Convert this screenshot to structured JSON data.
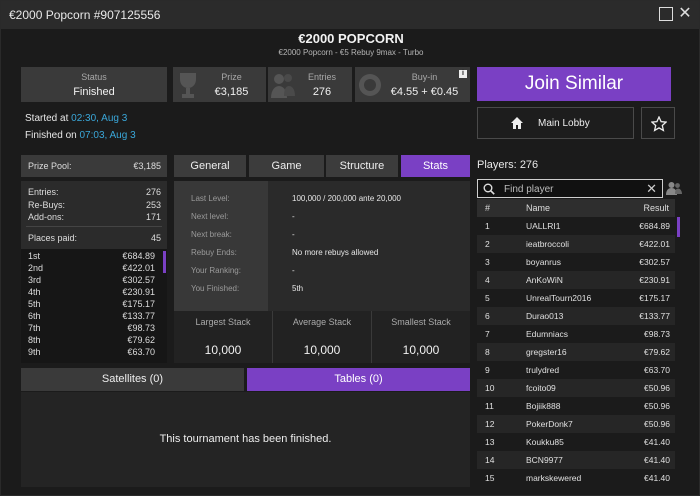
{
  "window": {
    "title": "€2000 Popcorn #907125556"
  },
  "header": {
    "title": "€2000 POPCORN",
    "subtitle": "€2000 Popcorn - €5 Rebuy 9max - Turbo"
  },
  "cards": {
    "status": {
      "label": "Status",
      "value": "Finished"
    },
    "prize": {
      "label": "Prize",
      "value": "€3,185"
    },
    "entries": {
      "label": "Entries",
      "value": "276"
    },
    "buyin": {
      "label": "Buy-in",
      "value": "€4.55 + €0.45"
    }
  },
  "times": {
    "started_label": "Started at",
    "started_value": "02:30, Aug 3",
    "finished_label": "Finished on",
    "finished_value": "07:03, Aug 3"
  },
  "actions": {
    "join": "Join Similar",
    "lobby": "Main Lobby"
  },
  "left_panel": {
    "prize_pool_label": "Prize Pool:",
    "prize_pool_value": "€3,185",
    "entries_label": "Entries:",
    "entries_value": "276",
    "rebuys_label": "Re-Buys:",
    "rebuys_value": "253",
    "addons_label": "Add-ons:",
    "addons_value": "171",
    "places_label": "Places paid:",
    "places_value": "45",
    "places": [
      {
        "place": "1st",
        "prize": "€684.89"
      },
      {
        "place": "2nd",
        "prize": "€422.01"
      },
      {
        "place": "3rd",
        "prize": "€302.57"
      },
      {
        "place": "4th",
        "prize": "€230.91"
      },
      {
        "place": "5th",
        "prize": "€175.17"
      },
      {
        "place": "6th",
        "prize": "€133.77"
      },
      {
        "place": "7th",
        "prize": "€98.73"
      },
      {
        "place": "8th",
        "prize": "€79.62"
      },
      {
        "place": "9th",
        "prize": "€63.70"
      }
    ]
  },
  "tabs": [
    "General",
    "Game",
    "Structure",
    "Stats"
  ],
  "stats": {
    "rows": [
      {
        "label": "Last Level:",
        "value": "100,000 / 200,000 ante 20,000"
      },
      {
        "label": "Next level:",
        "value": "-"
      },
      {
        "label": "Next break:",
        "value": "-"
      },
      {
        "label": "Rebuy Ends:",
        "value": "No more rebuys allowed"
      },
      {
        "label": "Your Ranking:",
        "value": "-"
      },
      {
        "label": "You Finished:",
        "value": "5th"
      }
    ],
    "stacks": [
      {
        "label": "Largest Stack",
        "value": "10,000"
      },
      {
        "label": "Average Stack",
        "value": "10,000"
      },
      {
        "label": "Smallest Stack",
        "value": "10,000"
      }
    ]
  },
  "bottom": {
    "tab_satellites": "Satellites (0)",
    "tab_tables": "Tables (0)",
    "message": "This tournament has been finished."
  },
  "players": {
    "header_label": "Players:",
    "count": "276",
    "search_placeholder": "Find player",
    "columns": [
      "#",
      "Name",
      "Result"
    ],
    "rows": [
      {
        "rank": "1",
        "name": "UALLRI1",
        "result": "€684.89"
      },
      {
        "rank": "2",
        "name": "ieatbroccoli",
        "result": "€422.01"
      },
      {
        "rank": "3",
        "name": "boyanrus",
        "result": "€302.57"
      },
      {
        "rank": "4",
        "name": "AnKoWiN",
        "result": "€230.91"
      },
      {
        "rank": "5",
        "name": "UnrealTourn2016",
        "result": "€175.17"
      },
      {
        "rank": "6",
        "name": "Durao013",
        "result": "€133.77"
      },
      {
        "rank": "7",
        "name": "Edumniacs",
        "result": "€98.73"
      },
      {
        "rank": "8",
        "name": "gregster16",
        "result": "€79.62"
      },
      {
        "rank": "9",
        "name": "trulydred",
        "result": "€63.70"
      },
      {
        "rank": "10",
        "name": "fcoito09",
        "result": "€50.96"
      },
      {
        "rank": "11",
        "name": "Bojiik888",
        "result": "€50.96"
      },
      {
        "rank": "12",
        "name": "PokerDonk7",
        "result": "€50.96"
      },
      {
        "rank": "13",
        "name": "Koukku85",
        "result": "€41.40"
      },
      {
        "rank": "14",
        "name": "BCN9977",
        "result": "€41.40"
      },
      {
        "rank": "15",
        "name": "markskewered",
        "result": "€41.40"
      }
    ]
  },
  "colors": {
    "accent": "#7a40c4",
    "link": "#3aa7d9"
  }
}
